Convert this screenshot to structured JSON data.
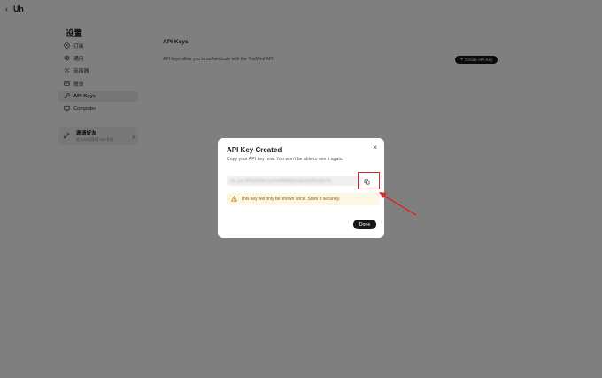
{
  "topbar": {
    "back_icon": "chevron-left-icon",
    "logo_text": "Uh"
  },
  "sidebar": {
    "title": "设置",
    "items": [
      {
        "label": "订阅",
        "icon": "clock-icon",
        "active": false
      },
      {
        "label": "通用",
        "icon": "gear-icon",
        "active": false
      },
      {
        "label": "连接器",
        "icon": "connector-icon",
        "active": false
      },
      {
        "label": "账单",
        "icon": "card-icon",
        "active": false
      },
      {
        "label": "API Keys",
        "icon": "key-icon",
        "active": true
      },
      {
        "label": "Computer",
        "icon": "monitor-icon",
        "active": false
      }
    ],
    "invite": {
      "title": "邀请好友",
      "subtitle": "双方均可获得 100 积分",
      "icon": "gift-icon"
    }
  },
  "main": {
    "title": "API Keys",
    "description": "API keys allow you to authenticate with the YouMind API.",
    "create_button": "Create API Key"
  },
  "modal": {
    "title": "API Key Created",
    "subtitle": "Copy your API key now. You won't be able to see it again.",
    "api_key": "sk-ym-8f3d2b9c1a7e4f6d0b5c8a2e9f1d3c7b",
    "copy_icon": "copy-icon",
    "warning": "This key will only be shown once. Store it securely.",
    "done_button": "Done",
    "close_icon": "close-icon"
  },
  "colors": {
    "annotation": "#e0242b",
    "overlay": "rgba(0,0,0,0.5)",
    "primary_button": "#161616",
    "warning_bg": "#fdf6e3"
  }
}
